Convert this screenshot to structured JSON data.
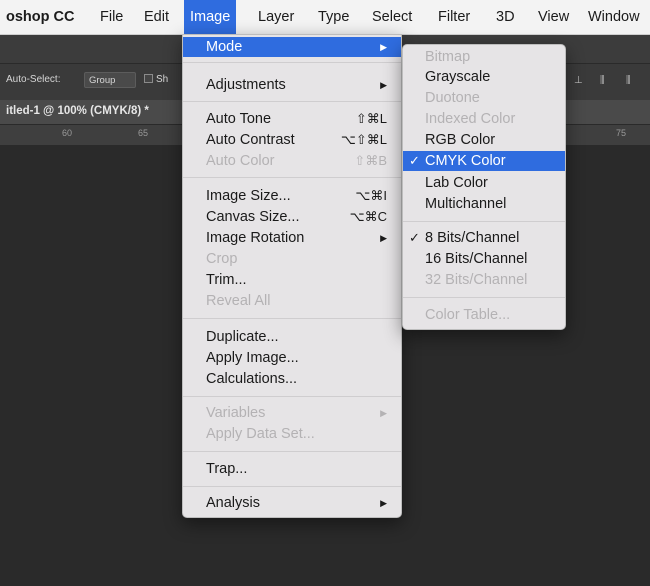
{
  "menubar": {
    "app": "oshop CC",
    "items": [
      "File",
      "Edit",
      "Image",
      "Layer",
      "Type",
      "Select",
      "Filter",
      "3D",
      "View",
      "Window"
    ],
    "active": "Image"
  },
  "options_bar": {
    "auto_select_label": "Auto-Select:",
    "auto_select_value": "Group",
    "show_label": "Sh"
  },
  "document": {
    "tab_title": "itled-1 @ 100% (CMYK/8) *",
    "ruler_labels": [
      "60",
      "65",
      "75"
    ]
  },
  "image_menu": {
    "items": [
      {
        "label": "Mode",
        "arrow": true,
        "highlighted": true
      },
      {
        "label": "Adjustments",
        "arrow": true
      },
      {
        "label": "Auto Tone",
        "shortcut": "⇧⌘L"
      },
      {
        "label": "Auto Contrast",
        "shortcut": "⌥⇧⌘L"
      },
      {
        "label": "Auto Color",
        "shortcut": "⇧⌘B",
        "disabled": true
      },
      {
        "label": "Image Size...",
        "shortcut": "⌥⌘I"
      },
      {
        "label": "Canvas Size...",
        "shortcut": "⌥⌘C"
      },
      {
        "label": "Image Rotation",
        "arrow": true
      },
      {
        "label": "Crop",
        "disabled": true
      },
      {
        "label": "Trim..."
      },
      {
        "label": "Reveal All",
        "disabled": true
      },
      {
        "label": "Duplicate..."
      },
      {
        "label": "Apply Image..."
      },
      {
        "label": "Calculations..."
      },
      {
        "label": "Variables",
        "arrow": true,
        "disabled": true
      },
      {
        "label": "Apply Data Set...",
        "disabled": true
      },
      {
        "label": "Trap..."
      },
      {
        "label": "Analysis",
        "arrow": true
      }
    ]
  },
  "mode_submenu": {
    "items": [
      {
        "label": "Bitmap",
        "disabled": true
      },
      {
        "label": "Grayscale"
      },
      {
        "label": "Duotone",
        "disabled": true
      },
      {
        "label": "Indexed Color",
        "disabled": true
      },
      {
        "label": "RGB Color"
      },
      {
        "label": "CMYK Color",
        "checked": true,
        "highlighted": true
      },
      {
        "label": "Lab Color"
      },
      {
        "label": "Multichannel"
      },
      {
        "label": "8 Bits/Channel",
        "checked": true
      },
      {
        "label": "16 Bits/Channel"
      },
      {
        "label": "32 Bits/Channel",
        "disabled": true
      },
      {
        "label": "Color Table...",
        "disabled": true
      }
    ],
    "check_glyph": "✓"
  },
  "colors": {
    "highlight": "#2f6cdf",
    "menu_bg": "#e6e4e6",
    "workspace": "#2a2a2a"
  },
  "icons": {
    "submenu_arrow": "triangle-right-icon",
    "check": "checkmark-icon"
  }
}
